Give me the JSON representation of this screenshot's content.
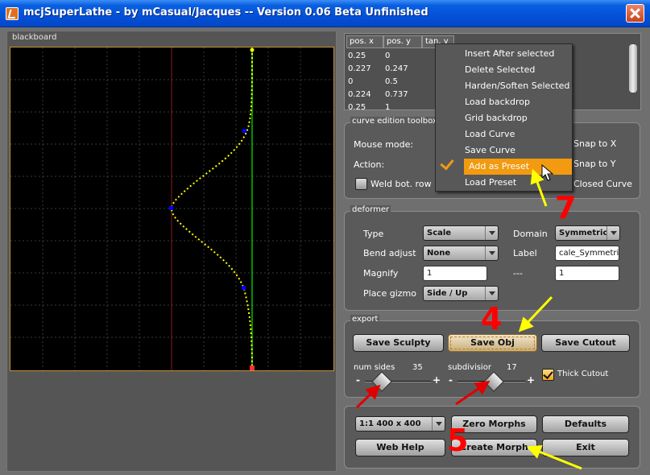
{
  "window": {
    "title": "mcjSuperLathe - by mCasual/Jacques -- Version 0.06 Beta Unfinished"
  },
  "blackboard": {
    "label": "blackboard"
  },
  "table": {
    "headers": [
      "pos. x",
      "pos. y",
      "tan. y"
    ],
    "rows": [
      [
        "0.25",
        "0"
      ],
      [
        "0.227",
        "0.247"
      ],
      [
        "0",
        "0.5"
      ],
      [
        "0.224",
        "0.737"
      ],
      [
        "0.25",
        "1"
      ]
    ]
  },
  "toolbox": {
    "label": "curve edition toolbox",
    "mouse_mode_label": "Mouse mode:",
    "action_label": "Action:",
    "weld_label": "Weld bot. row",
    "snap_x": "Snap to X",
    "snap_y": "Snap to Y",
    "closed_curve": "Closed Curve"
  },
  "menu": {
    "items": [
      "Insert After selected",
      "Delete Selected",
      "Harden/Soften Selected",
      "Load backdrop",
      "Grid backdrop",
      "Load Curve",
      "Save Curve",
      "Add as Preset",
      "Load Preset"
    ],
    "selected": "Add as Preset"
  },
  "deformer": {
    "label": "deformer",
    "type_label": "Type",
    "type_value": "Scale",
    "domain_label": "Domain",
    "domain_value": "Symmetric",
    "bend_label": "Bend adjust",
    "bend_value": "None",
    "label_label": "Label",
    "label_value": "cale_Symmetric",
    "magnify_label": "Magnify",
    "magnify_value": "1",
    "dash_label": "---",
    "dash_value": "1",
    "gizmo_label": "Place gizmo",
    "gizmo_value": "Side / Up"
  },
  "export": {
    "label": "export",
    "save_sculpty": "Save Sculpty",
    "save_obj": "Save Obj",
    "save_cutout": "Save Cutout",
    "num_sides_label": "num sides",
    "num_sides_value": "35",
    "subdiv_label": "subdivisior",
    "subdiv_value": "17",
    "thick_cutout": "Thick Cutout",
    "minus": "-",
    "plus": "+"
  },
  "bottom": {
    "resolution": "1:1  400 x 400",
    "zero_morphs": "Zero Morphs",
    "defaults": "Defaults",
    "web_help": "Web Help",
    "create_morph": "Create Morph",
    "exit": "Exit"
  },
  "annotations": {
    "n4": "4",
    "n5": "5",
    "n7": "7"
  },
  "colors": {
    "curve": "#ffff00",
    "control_point": "#0000ff",
    "axis_line": "#00c000",
    "frame_accent": "#c89030",
    "menu_highlight": "#f29a10",
    "annotation": "#ff0000",
    "arrow_yellow": "#ffff00"
  }
}
